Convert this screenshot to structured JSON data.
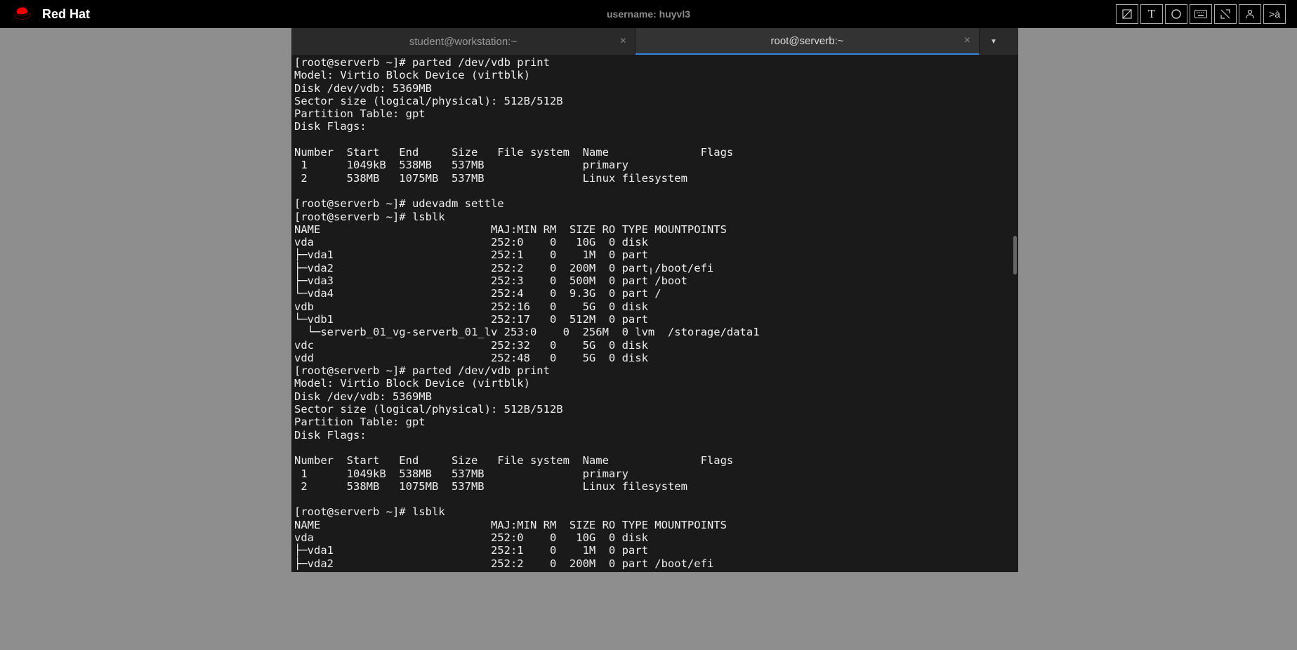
{
  "header": {
    "brand": "Red Hat",
    "username_label": "username: huyvl3"
  },
  "toolbar": {
    "btn1": "layers-icon",
    "btn2": "T",
    "btn3": "circle-icon",
    "btn4": "keyboard-icon",
    "btn5": "minimize-icon",
    "btn6": "user-icon",
    "btn7": ">à"
  },
  "tabs": {
    "tab1": {
      "label": "student@workstation:~"
    },
    "tab2": {
      "label": "root@serverb:~"
    }
  },
  "terminal": {
    "content": "[root@serverb ~]# parted /dev/vdb print\nModel: Virtio Block Device (virtblk)\nDisk /dev/vdb: 5369MB\nSector size (logical/physical): 512B/512B\nPartition Table: gpt\nDisk Flags:\n\nNumber  Start   End     Size   File system  Name              Flags\n 1      1049kB  538MB   537MB               primary\n 2      538MB   1075MB  537MB               Linux filesystem\n\n[root@serverb ~]# udevadm settle\n[root@serverb ~]# lsblk\nNAME                          MAJ:MIN RM  SIZE RO TYPE MOUNTPOINTS\nvda                           252:0    0   10G  0 disk\n├─vda1                        252:1    0    1M  0 part\n├─vda2                        252:2    0  200M  0 part /boot/efi\n├─vda3                        252:3    0  500M  0 part /boot\n└─vda4                        252:4    0  9.3G  0 part /\nvdb                           252:16   0    5G  0 disk\n└─vdb1                        252:17   0  512M  0 part\n  └─serverb_01_vg-serverb_01_lv 253:0    0  256M  0 lvm  /storage/data1\nvdc                           252:32   0    5G  0 disk\nvdd                           252:48   0    5G  0 disk\n[root@serverb ~]# parted /dev/vdb print\nModel: Virtio Block Device (virtblk)\nDisk /dev/vdb: 5369MB\nSector size (logical/physical): 512B/512B\nPartition Table: gpt\nDisk Flags:\n\nNumber  Start   End     Size   File system  Name              Flags\n 1      1049kB  538MB   537MB               primary\n 2      538MB   1075MB  537MB               Linux filesystem\n\n[root@serverb ~]# lsblk\nNAME                          MAJ:MIN RM  SIZE RO TYPE MOUNTPOINTS\nvda                           252:0    0   10G  0 disk\n├─vda1                        252:1    0    1M  0 part\n├─vda2                        252:2    0  200M  0 part /boot/efi"
  }
}
